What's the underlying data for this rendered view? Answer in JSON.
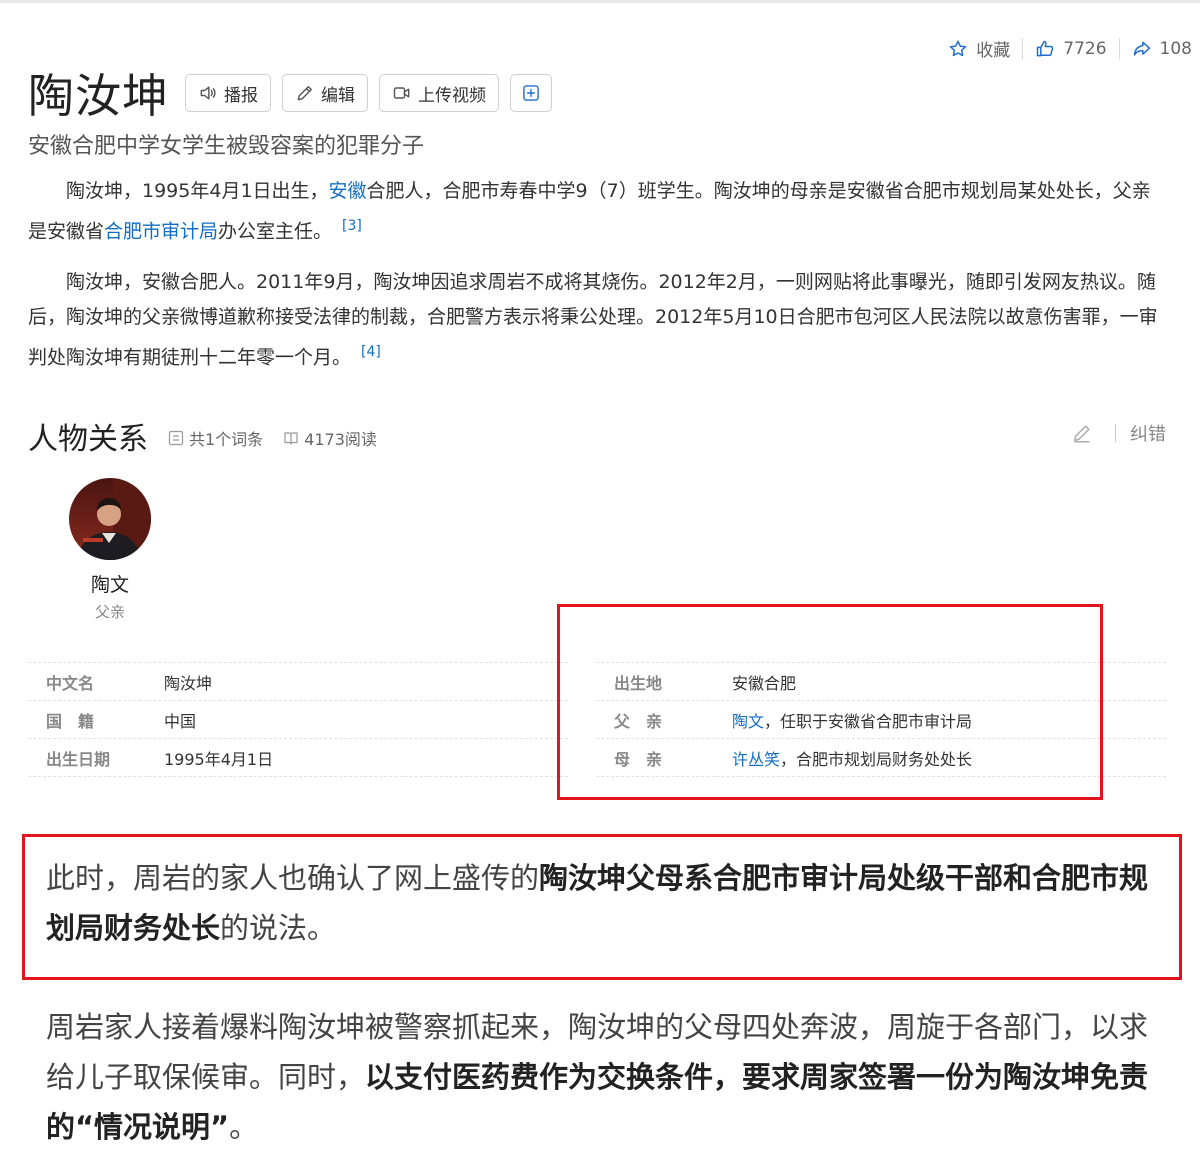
{
  "actions": {
    "favorite_label": "收藏",
    "like_count": "7726",
    "share_count": "108"
  },
  "header": {
    "title": "陶汝坤",
    "buttons": {
      "broadcast": "播报",
      "edit": "编辑",
      "upload_video": "上传视频"
    },
    "subtitle": "安徽合肥中学女学生被毁容案的犯罪分子"
  },
  "intro": {
    "p1_a": "陶汝坤，1995年4月1日出生，",
    "p1_link1": "安徽",
    "p1_b": "合肥人，合肥市寿春中学9（7）班学生。陶汝坤的母亲是安徽省合肥市规划局某处处长，父亲是安徽省",
    "p1_link2": "合肥市审计局",
    "p1_c": "办公室主任。",
    "p1_ref": "[3]",
    "p2": "陶汝坤，安徽合肥人。2011年9月，陶汝坤因追求周岩不成将其烧伤。2012年2月，一则网贴将此事曝光，随即引发网友热议。随后，陶汝坤的父亲微博道歉称接受法律的制裁，合肥警方表示将秉公处理。2012年5月10日合肥市包河区人民法院以故意伤害罪，一审判处陶汝坤有期徒刑十二年零一个月。",
    "p2_ref": "[4]"
  },
  "relations": {
    "title": "人物关系",
    "entries_label": "共1个词条",
    "reads_label": "4173阅读",
    "correct_label": "纠错",
    "person": {
      "name": "陶文",
      "relation": "父亲"
    }
  },
  "infobox": {
    "left": [
      {
        "key": "中文名",
        "value": "陶汝坤"
      },
      {
        "key": "国　籍",
        "value": "中国",
        "link": true
      },
      {
        "key": "出生日期",
        "value": "1995年4月1日"
      }
    ],
    "right": [
      {
        "key": "出生地",
        "value": "安徽合肥"
      },
      {
        "key": "父　亲",
        "value_link": "陶文",
        "value_rest": "，任职于安徽省合肥市审计局"
      },
      {
        "key": "母　亲",
        "value_link": "许丛笑",
        "value_rest": "，合肥市规划局财务处处长"
      }
    ]
  },
  "article": {
    "q1_a": "此时，周岩的家人也确认了网上盛传的",
    "q1_bold": "陶汝坤父母系合肥市审计局处级干部和合肥市规划局财务处长",
    "q1_b": "的说法。",
    "q2_a": "周岩家人接着爆料陶汝坤被警察抓起来，陶汝坤的父母四处奔波，周旋于各部门，以求给儿子取保候审。同时，",
    "q2_bold": "以支付医药费作为交换条件，要求周家签署一份为陶汝坤免责的“情况说明”",
    "q2_b": "。"
  },
  "colors": {
    "link": "#136ec2",
    "highlight_box": "#e3141d"
  }
}
